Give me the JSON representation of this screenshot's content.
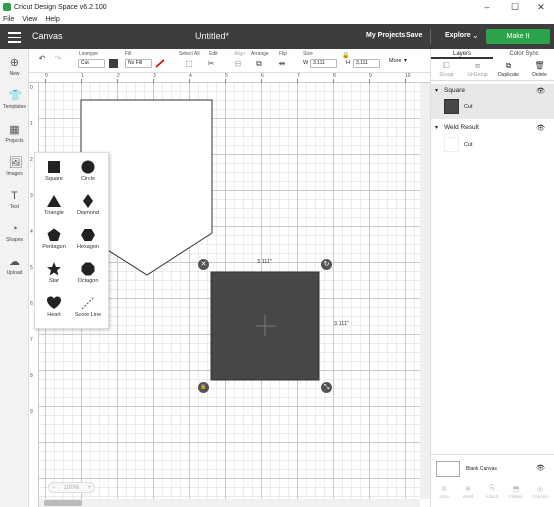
{
  "window": {
    "title": "Cricut Design Space  v6.2.100",
    "minimize": "–",
    "maximize": "☐",
    "close": "✕"
  },
  "menu": [
    "File",
    "View",
    "Help"
  ],
  "header": {
    "section": "Canvas",
    "document": "Untitled*",
    "my_projects": "My Projects",
    "save": "Save",
    "explore": "Explore",
    "make_it": "Make It"
  },
  "toolbar": {
    "undo": "↶",
    "redo": "↷",
    "linetype_label": "Linetype",
    "linetype_value": "Cut",
    "fill_label": "Fill",
    "fill_value": "No Fill",
    "selectall_label": "Select All",
    "edit_label": "Edit",
    "align_label": "Align",
    "arrange_label": "Arrange",
    "flip_label": "Flip",
    "size_label": "Size",
    "w_label": "W",
    "w_value": "3.111",
    "h_label": "H",
    "h_value": "3.111",
    "more_label": "More"
  },
  "leftbar": [
    {
      "label": "New",
      "icon": "plus-icon",
      "glyph": "⊕"
    },
    {
      "label": "Templates",
      "icon": "shirt-icon",
      "glyph": "👕"
    },
    {
      "label": "Projects",
      "icon": "projects-icon",
      "glyph": "▦"
    },
    {
      "label": "Images",
      "icon": "images-icon",
      "glyph": "🖼"
    },
    {
      "label": "Text",
      "icon": "text-icon",
      "glyph": "T"
    },
    {
      "label": "Shapes",
      "icon": "shapes-icon",
      "glyph": "◔"
    },
    {
      "label": "Upload",
      "icon": "upload-icon",
      "glyph": "☁"
    }
  ],
  "ruler": {
    "top": [
      "0",
      "1",
      "2",
      "3",
      "4",
      "5",
      "6",
      "7",
      "8",
      "9",
      "10"
    ],
    "left": [
      "0",
      "1",
      "2",
      "3",
      "4",
      "5",
      "6",
      "7",
      "8",
      "9"
    ]
  },
  "shapes": [
    {
      "label": "Square",
      "icon": "square-shape-icon"
    },
    {
      "label": "Circle",
      "icon": "circle-shape-icon"
    },
    {
      "label": "Triangle",
      "icon": "triangle-shape-icon"
    },
    {
      "label": "Diamond",
      "icon": "diamond-shape-icon"
    },
    {
      "label": "Pentagon",
      "icon": "pentagon-shape-icon"
    },
    {
      "label": "Hexagon",
      "icon": "hexagon-shape-icon"
    },
    {
      "label": "Star",
      "icon": "star-shape-icon"
    },
    {
      "label": "Octagon",
      "icon": "octagon-shape-icon"
    },
    {
      "label": "Heart",
      "icon": "heart-shape-icon"
    },
    {
      "label": "Score Line",
      "icon": "score-line-icon"
    }
  ],
  "selection": {
    "width_label": "3.111\"",
    "height_label": "3.111\"",
    "close": "✕",
    "rotate": "↻",
    "lock": "🔒",
    "resize": "⤡"
  },
  "zoom": {
    "minus": "−",
    "value": "100%",
    "plus": "+"
  },
  "rightpanel": {
    "tabs": [
      "Layers",
      "Color Sync"
    ],
    "actions": [
      {
        "label": "Group",
        "icon": "group-icon",
        "enabled": false
      },
      {
        "label": "UnGroup",
        "icon": "ungroup-icon",
        "enabled": false
      },
      {
        "label": "Duplicate",
        "icon": "duplicate-icon",
        "enabled": true
      },
      {
        "label": "Delete",
        "icon": "delete-icon",
        "enabled": true
      }
    ],
    "layers": [
      {
        "name": "Square",
        "op": "Cut",
        "swatch": "#474747",
        "selected": true
      },
      {
        "name": "Weld Result",
        "op": "Cut",
        "swatch": "#ffffff",
        "selected": false
      }
    ],
    "blank_canvas": "Blank Canvas",
    "bottom_actions": [
      "Slice",
      "Weld",
      "Attach",
      "Flatten",
      "Contour"
    ]
  },
  "colors": {
    "header": "#3d3d3d",
    "make_it": "#2ca24a",
    "selected_shape": "#474747"
  }
}
